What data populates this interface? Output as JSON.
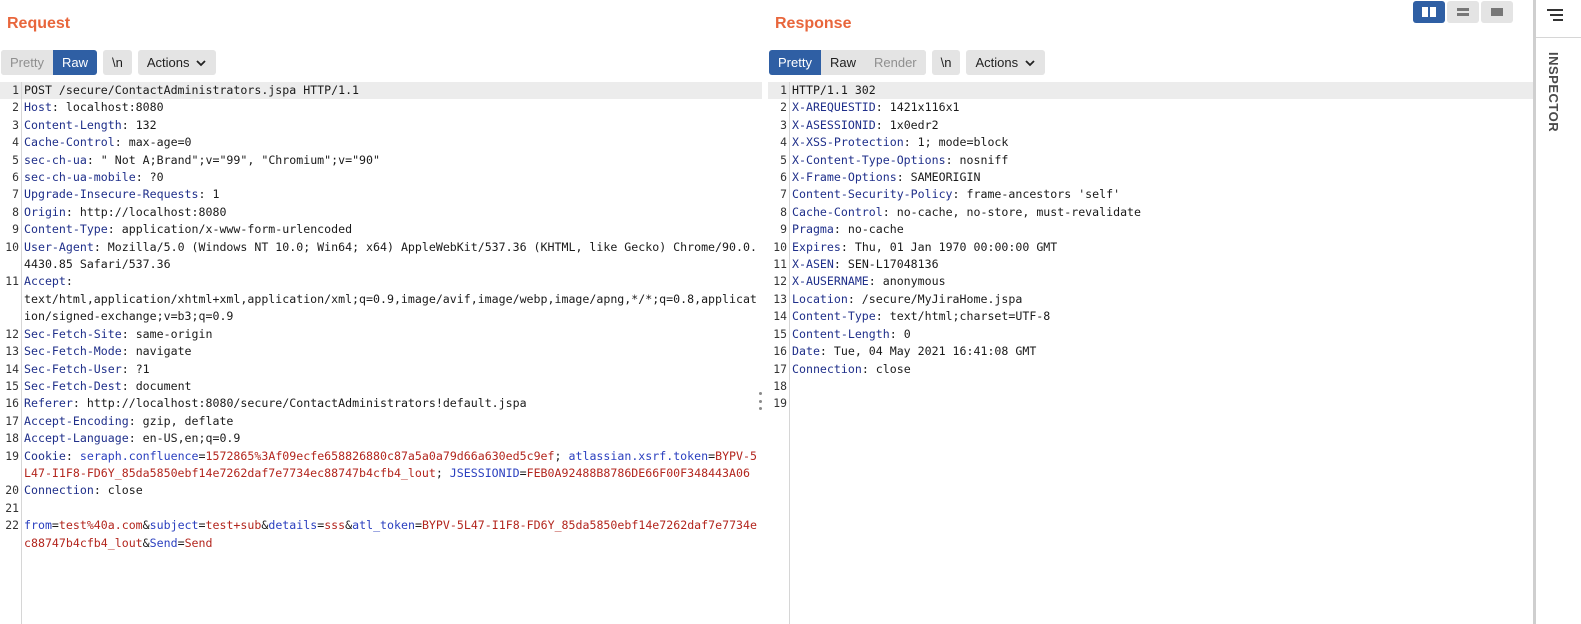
{
  "request": {
    "title": "Request",
    "view_options": [
      {
        "label": "Pretty",
        "state": "disabled"
      },
      {
        "label": "Raw",
        "state": "active"
      }
    ],
    "newline_label": "\\n",
    "actions_label": "Actions",
    "lines": [
      {
        "n": "1",
        "text": "POST /secure/ContactAdministrators.jspa HTTP/1.1"
      },
      {
        "n": "2",
        "name": "Host",
        "value": " localhost:8080"
      },
      {
        "n": "3",
        "name": "Content-Length",
        "value": " 132"
      },
      {
        "n": "4",
        "name": "Cache-Control",
        "value": " max-age=0"
      },
      {
        "n": "5",
        "name": "sec-ch-ua",
        "value": " \" Not A;Brand\";v=\"99\", \"Chromium\";v=\"90\""
      },
      {
        "n": "6",
        "name": "sec-ch-ua-mobile",
        "value": " ?0"
      },
      {
        "n": "7",
        "name": "Upgrade-Insecure-Requests",
        "value": " 1"
      },
      {
        "n": "8",
        "name": "Origin",
        "value": " http://localhost:8080"
      },
      {
        "n": "9",
        "name": "Content-Type",
        "value": " application/x-www-form-urlencoded"
      },
      {
        "n": "10",
        "name": "User-Agent",
        "value": " Mozilla/5.0 (Windows NT 10.0; Win64; x64) AppleWebKit/537.36 (KHTML, like Gecko) Chrome/90.0.4430.85 Safari/537.36"
      },
      {
        "n": "11",
        "name": "Accept",
        "value": "\ntext/html,application/xhtml+xml,application/xml;q=0.9,image/avif,image/webp,image/apng,*/*;q=0.8,application/signed-exchange;v=b3;q=0.9"
      },
      {
        "n": "12",
        "name": "Sec-Fetch-Site",
        "value": " same-origin"
      },
      {
        "n": "13",
        "name": "Sec-Fetch-Mode",
        "value": " navigate"
      },
      {
        "n": "14",
        "name": "Sec-Fetch-User",
        "value": " ?1"
      },
      {
        "n": "15",
        "name": "Sec-Fetch-Dest",
        "value": " document"
      },
      {
        "n": "16",
        "name": "Referer",
        "value": " http://localhost:8080/secure/ContactAdministrators!default.jspa"
      },
      {
        "n": "17",
        "name": "Accept-Encoding",
        "value": " gzip, deflate"
      },
      {
        "n": "18",
        "name": "Accept-Language",
        "value": " en-US,en;q=0.9"
      },
      {
        "n": "19",
        "name": "Cookie",
        "cookies": [
          {
            "key": "seraph.confluence",
            "value": "1572865%3Af09ecfe658826880c87a5a0a79d66a630ed5c9ef"
          },
          {
            "key": "atlassian.xsrf.token",
            "value": "BYPV-5L47-I1F8-FD6Y_85da5850ebf14e7262daf7e7734ec88747b4cfb4_lout"
          },
          {
            "key": "JSESSIONID",
            "value": "FEB0A92488B8786DE66F00F348443A06"
          }
        ]
      },
      {
        "n": "20",
        "name": "Connection",
        "value": " close"
      },
      {
        "n": "21",
        "text": ""
      },
      {
        "n": "22",
        "params": [
          {
            "key": "from",
            "value": "test%40a.com"
          },
          {
            "key": "subject",
            "value": "test+sub"
          },
          {
            "key": "details",
            "value": "sss"
          },
          {
            "key": "atl_token",
            "value": "BYPV-5L47-I1F8-FD6Y_85da5850ebf14e7262daf7e7734ec88747b4cfb4_lout"
          },
          {
            "key": "Send",
            "value": "Send"
          }
        ]
      }
    ]
  },
  "response": {
    "title": "Response",
    "view_options": [
      {
        "label": "Pretty",
        "state": "active"
      },
      {
        "label": "Raw",
        "state": "normal"
      },
      {
        "label": "Render",
        "state": "disabled"
      }
    ],
    "newline_label": "\\n",
    "actions_label": "Actions",
    "lines": [
      {
        "n": "1",
        "text": "HTTP/1.1 302"
      },
      {
        "n": "2",
        "name": "X-AREQUESTID",
        "value": " 1421x116x1"
      },
      {
        "n": "3",
        "name": "X-ASESSIONID",
        "value": " 1x0edr2"
      },
      {
        "n": "4",
        "name": "X-XSS-Protection",
        "value": " 1; mode=block"
      },
      {
        "n": "5",
        "name": "X-Content-Type-Options",
        "value": " nosniff"
      },
      {
        "n": "6",
        "name": "X-Frame-Options",
        "value": " SAMEORIGIN"
      },
      {
        "n": "7",
        "name": "Content-Security-Policy",
        "value": " frame-ancestors 'self'"
      },
      {
        "n": "8",
        "name": "Cache-Control",
        "value": " no-cache, no-store, must-revalidate"
      },
      {
        "n": "9",
        "name": "Pragma",
        "value": " no-cache"
      },
      {
        "n": "10",
        "name": "Expires",
        "value": " Thu, 01 Jan 1970 00:00:00 GMT"
      },
      {
        "n": "11",
        "name": "X-ASEN",
        "value": " SEN-L17048136"
      },
      {
        "n": "12",
        "name": "X-AUSERNAME",
        "value": " anonymous"
      },
      {
        "n": "13",
        "name": "Location",
        "value": " /secure/MyJiraHome.jspa"
      },
      {
        "n": "14",
        "name": "Content-Type",
        "value": " text/html;charset=UTF-8"
      },
      {
        "n": "15",
        "name": "Content-Length",
        "value": " 0"
      },
      {
        "n": "16",
        "name": "Date",
        "value": " Tue, 04 May 2021 16:41:08 GMT"
      },
      {
        "n": "17",
        "name": "Connection",
        "value": " close"
      },
      {
        "n": "18",
        "text": ""
      },
      {
        "n": "19",
        "text": ""
      }
    ]
  },
  "layout_switcher": [
    {
      "icon": "split-columns-icon",
      "state": "active"
    },
    {
      "icon": "split-rows-icon",
      "state": "normal"
    },
    {
      "icon": "single-pane-icon",
      "state": "normal"
    }
  ],
  "inspector": {
    "label": "INSPECTOR",
    "menu_icon": "hamburger-menu-icon"
  },
  "colors": {
    "title": "#e8663c",
    "active_button": "#2f5fa4",
    "header_name": "#1f2f8a",
    "param_key": "#2a3fbf",
    "param_value": "#b3261e"
  }
}
